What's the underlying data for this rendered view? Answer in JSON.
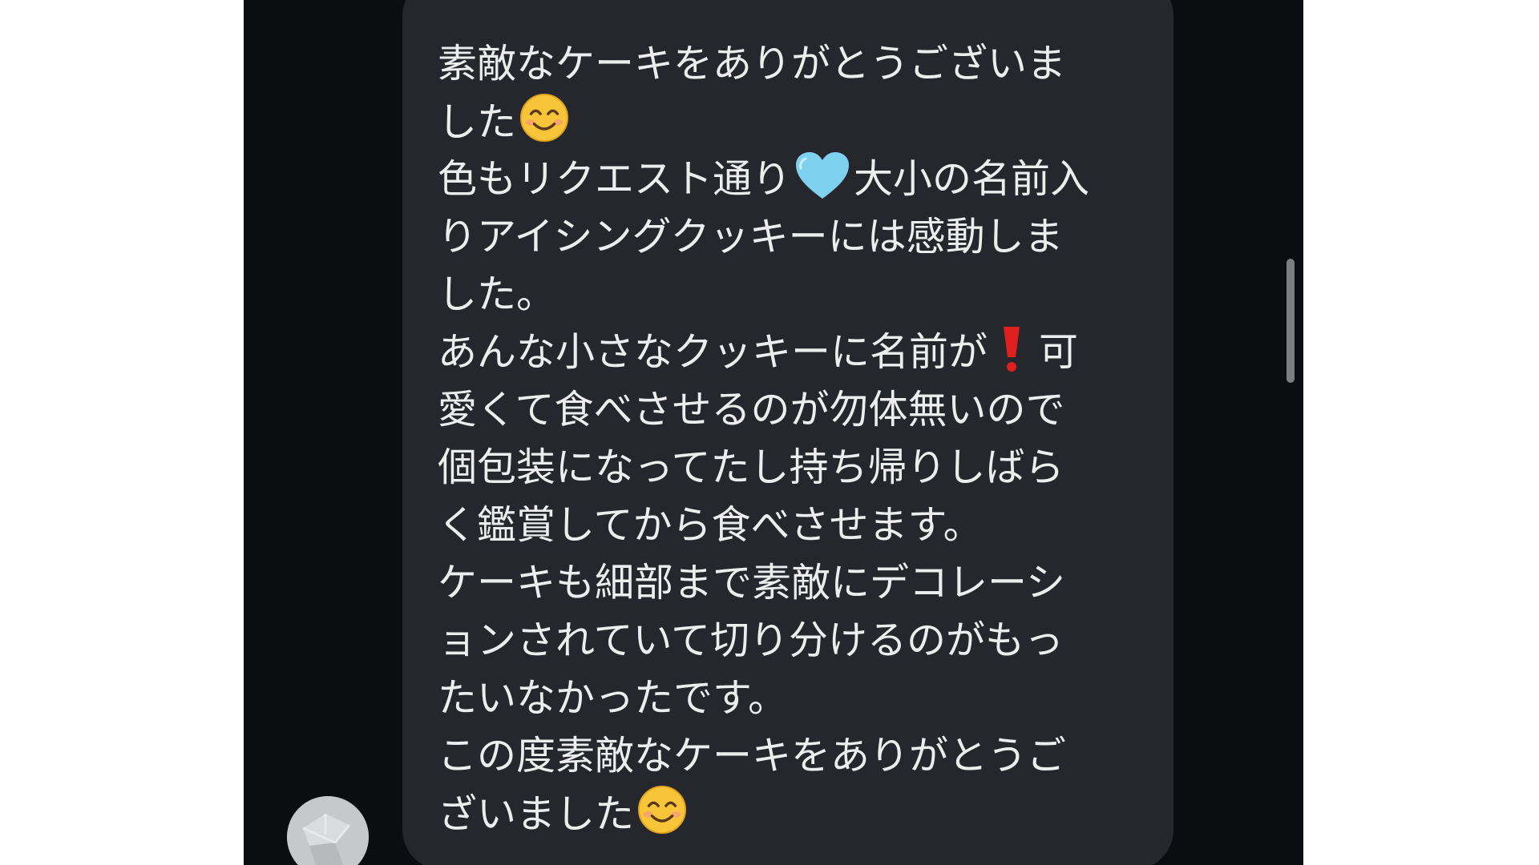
{
  "message": {
    "lines": [
      {
        "text": "素敵なケーキをありがとうございま"
      },
      {
        "text": "した",
        "after": {
          "icon": "smiling-face-icon"
        }
      },
      {
        "text": "色もリクエスト通り",
        "middle": {
          "icon": "light-blue-heart-icon"
        },
        "rest": "大小の名前入"
      },
      {
        "text": "りアイシングクッキーには感動しま"
      },
      {
        "text": "した。"
      },
      {
        "text": "あんな小さなクッキーに名前が",
        "middle": {
          "icon": "red-exclamation-icon"
        },
        "rest": "可"
      },
      {
        "text": "愛くて食べさせるのが勿体無いので"
      },
      {
        "text": "個包装になってたし持ち帰りしばら"
      },
      {
        "text": "く鑑賞してから食べさせます。"
      },
      {
        "text": "ケーキも細部まで素敵にデコレーシ"
      },
      {
        "text": "ョンされていて切り分けるのがもっ"
      },
      {
        "text": "たいなかったです。"
      },
      {
        "text": "この度素敵なケーキをありがとうご"
      },
      {
        "text": "ざいました",
        "after": {
          "icon": "smiling-face-icon"
        }
      }
    ]
  },
  "colors": {
    "screen_background": "#0b0d11",
    "bubble_background": "#25272c",
    "text": "#ededed",
    "heart": "#7fd1f0",
    "exclamation": "#e0201f",
    "emoji_face": "#f8c43a"
  },
  "avatar": {
    "icon": "default-avatar-icon"
  },
  "scrollbar": {
    "icon": "scrollbar-thumb"
  }
}
